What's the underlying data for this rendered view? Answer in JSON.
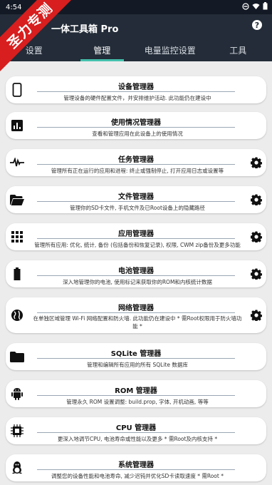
{
  "status_bar": {
    "time": "4:54"
  },
  "app_title": "一体工具箱 Pro",
  "ribbon_text": "圣力专测",
  "tabs": [
    {
      "label": "设置"
    },
    {
      "label": "管理"
    },
    {
      "label": "电量监控设置"
    },
    {
      "label": "工具"
    }
  ],
  "managers": [
    {
      "title": "设备管理器",
      "desc": "管理设备的硬件配置文件，并安排维护活动. 此功能仍在建设中",
      "icon": "phone-icon"
    },
    {
      "title": "使用情况管理器",
      "desc": "查看和管理应用在此设备上的使用情况",
      "icon": "bar-chart-icon"
    },
    {
      "title": "任务管理器",
      "desc": "管理所有正在运行的应用和进程: 终止或强制停止, 打开应用日志或设置等",
      "icon": "pulse-icon"
    },
    {
      "title": "文件管理器",
      "desc": "管理你的SD卡文件, 手机文件及已Root设备上的隐藏路径",
      "icon": "folder-icon"
    },
    {
      "title": "应用管理器",
      "desc": "管理所有应用: 优化, 统计, 备份 (包括备份和恢复记录), 权限, CWM zip备份及更多功能",
      "icon": "grid-icon"
    },
    {
      "title": "电池管理器",
      "desc": "深入地管理你的电池, 使用标记来获取你的ROM和内核统计数据",
      "icon": "battery-icon"
    },
    {
      "title": "网络管理器",
      "desc": "在单独区域管理 Wi-Fi 网络配置和防火墙. 此功能仍在建设中 * 需Root权限用于防火墙功能 *",
      "icon": "globe-icon"
    },
    {
      "title": "SQLite 管理器",
      "desc": "管理和编辑所有应用的所有 SQLite 数据库",
      "icon": "folder-icon"
    },
    {
      "title": "ROM 管理器",
      "desc": "管理永久 ROM 设置调整: build.prop, 字体, 开机动画, 等等",
      "icon": "android-icon"
    },
    {
      "title": "CPU 管理器",
      "desc": "更深入地调节CPU, 电池寿命或性能以及更多 * 需Root及内核支持 *",
      "icon": "cpu-icon"
    },
    {
      "title": "系统管理器",
      "desc": "调整您的设备性能和电池寿命, 减少迟钝并优化SD卡读取速度 * 需Root *",
      "icon": "linux-icon"
    }
  ]
}
